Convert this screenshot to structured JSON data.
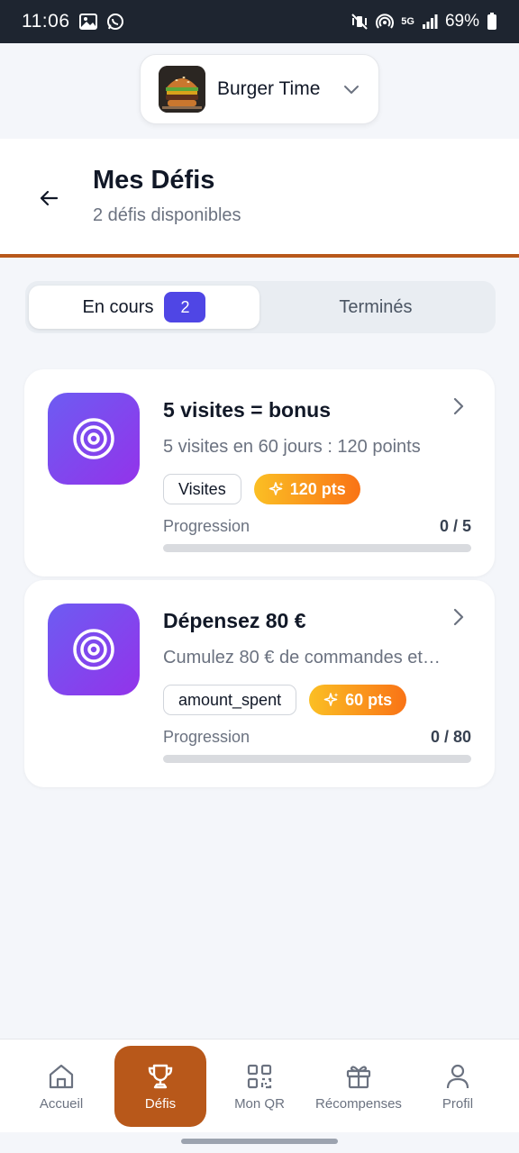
{
  "status_bar": {
    "time": "11:06",
    "network": "5G",
    "battery": "69%"
  },
  "restaurant_selector": {
    "name": "Burger Time"
  },
  "header": {
    "title": "Mes Défis",
    "subtitle": "2 défis disponibles"
  },
  "tabs": {
    "active_label": "En cours",
    "active_count": "2",
    "inactive_label": "Terminés"
  },
  "challenges": [
    {
      "title": "5 visites = bonus",
      "description": "5 visites en 60 jours : 120 points",
      "tag": "Visites",
      "points": "120 pts",
      "progress_label": "Progression",
      "progress_text": "0 / 5",
      "progress_fraction": 0
    },
    {
      "title": "Dépensez 80 €",
      "description": "Cumulez 80 € de commandes et…",
      "tag": "amount_spent",
      "points": "60 pts",
      "progress_label": "Progression",
      "progress_text": "0 / 80",
      "progress_fraction": 0
    }
  ],
  "bottom_nav": {
    "items": [
      {
        "label": "Accueil",
        "icon": "home-icon"
      },
      {
        "label": "Défis",
        "icon": "trophy-icon"
      },
      {
        "label": "Mon QR",
        "icon": "qr-code-icon"
      },
      {
        "label": "Récompenses",
        "icon": "gift-icon"
      },
      {
        "label": "Profil",
        "icon": "user-icon"
      }
    ],
    "active": "Défis"
  },
  "colors": {
    "accent": "#b8581a",
    "badge": "#4f46e5",
    "icon_gradient_start": "#6d5cf2",
    "icon_gradient_end": "#9333ea",
    "points_gradient_start": "#fbbf24",
    "points_gradient_end": "#f97316"
  }
}
